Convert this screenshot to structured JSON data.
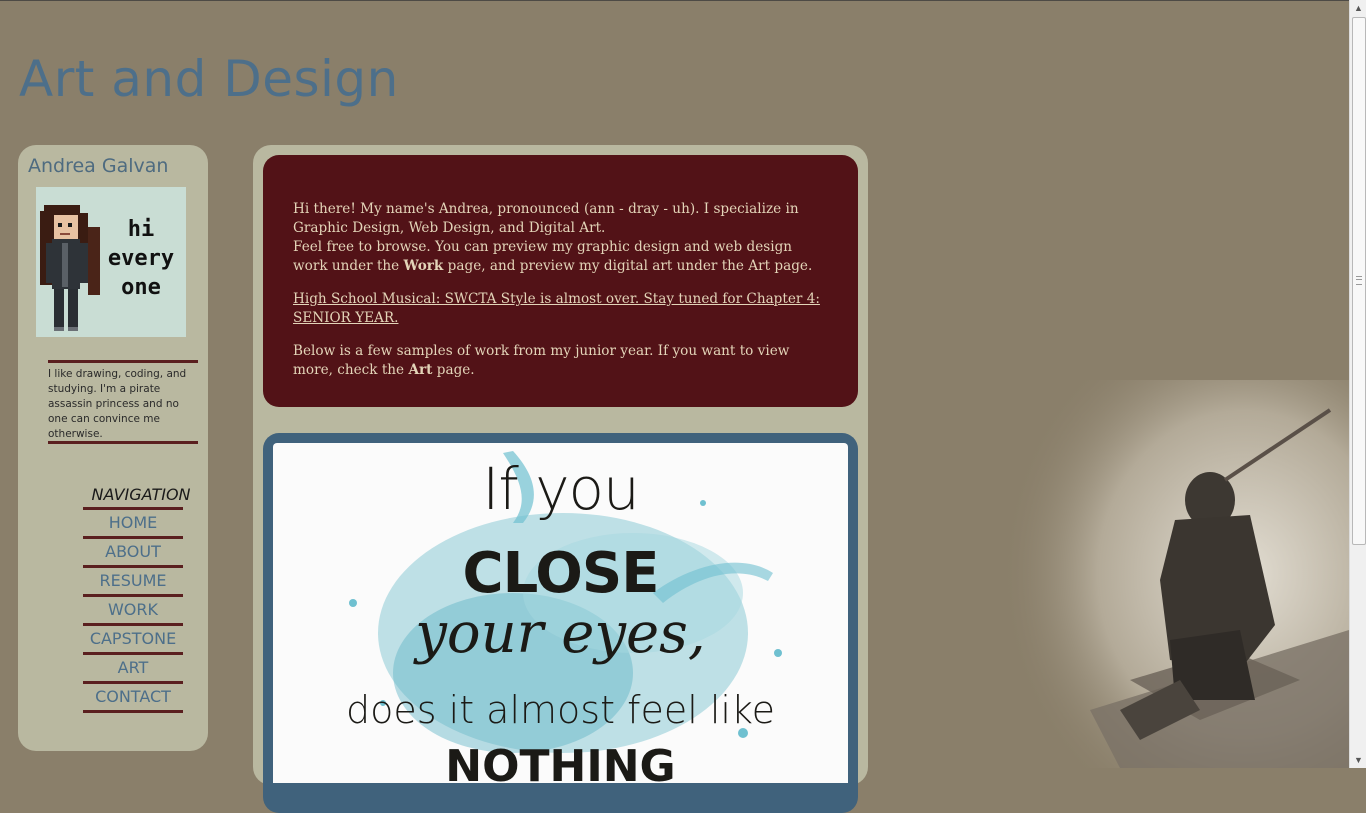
{
  "site": {
    "title": "Art and Design"
  },
  "sidebar": {
    "author_name": "Andrea Galvan",
    "avatar_text": "hi every one",
    "bio": "I like drawing, coding, and studying. I'm a pirate assassin princess and no one can convince me otherwise.",
    "nav_heading": "NAVIGATION",
    "nav_items": [
      {
        "label": "HOME"
      },
      {
        "label": "ABOUT"
      },
      {
        "label": "RESUME"
      },
      {
        "label": "WORK"
      },
      {
        "label": "CAPSTONE"
      },
      {
        "label": "ART"
      },
      {
        "label": "CONTACT"
      }
    ]
  },
  "main": {
    "intro": {
      "line1": "Hi there! My name's Andrea, pronounced (ann - dray - uh). I specialize in Graphic Design, Web Design, and Digital Art.",
      "line2_a": "Feel free to browse. You can preview my graphic design and web design work under the ",
      "line2_bold": "Work",
      "line2_b": " page, and preview my digital art under the Art page.",
      "announcement_link": "High School Musical: SWCTA Style is almost over. Stay tuned for Chapter 4: SENIOR YEAR.",
      "line3_a": "Below is a few samples of work from my junior year. If you want to view more, check the ",
      "line3_bold": "Art",
      "line3_b": " page."
    },
    "artwork": {
      "l1": "If you",
      "l2": "CLOSE",
      "l3": "your eyes,",
      "l4": "does it almost feel like",
      "l5": "NOTHING"
    }
  },
  "colors": {
    "page_bg": "#8a7f6a",
    "panel_bg": "#b9b8a0",
    "accent_blue": "#4d6f8a",
    "maroon": "#521217",
    "showcase_frame": "#40627c",
    "intro_text": "#e3d4b8"
  }
}
